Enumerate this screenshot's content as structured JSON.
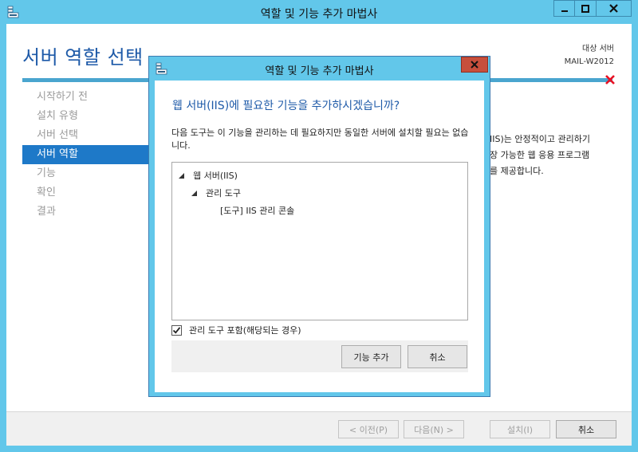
{
  "main_window": {
    "title": "역할 및 기능 추가 마법사",
    "page_title": "서버 역할 선택",
    "target_server_label": "대상 서버",
    "target_server_name": "MAIL-W2012",
    "nav_items": [
      {
        "label": "시작하기 전",
        "active": false
      },
      {
        "label": "설치 유형",
        "active": false
      },
      {
        "label": "서버 선택",
        "active": false
      },
      {
        "label": "서버 역할",
        "active": true
      },
      {
        "label": "기능",
        "active": false
      },
      {
        "label": "확인",
        "active": false
      },
      {
        "label": "결과",
        "active": false
      }
    ],
    "description_lines": [
      "IIS)는 안정적이고 관리하기",
      "장 가능한 웹 응용 프로그램",
      "를 제공합니다."
    ],
    "buttons": {
      "prev": "< 이전(P)",
      "next": "다음(N) >",
      "install": "설치(I)",
      "cancel": "취소"
    }
  },
  "dialog": {
    "title": "역할 및 기능 추가 마법사",
    "heading": "웹 서버(IIS)에 필요한 기능을 추가하시겠습니까?",
    "description": "다음 도구는 이 기능을 관리하는 데 필요하지만 동일한 서버에 설치할 필요는 없습니다.",
    "tree": [
      {
        "label": "웹 서버(IIS)",
        "level": 0,
        "expanded": true
      },
      {
        "label": "관리 도구",
        "level": 1,
        "expanded": true
      },
      {
        "label": "[도구] IIS 관리 콘솔",
        "level": 2,
        "expanded": false
      }
    ],
    "include_tools_label": "관리 도구 포함(해당되는 경우)",
    "include_tools_checked": true,
    "buttons": {
      "add_features": "기능 추가",
      "cancel": "취소"
    }
  },
  "colors": {
    "chrome": "#62c7ea",
    "accent": "#1e5aa8",
    "nav_active": "#1e79c8",
    "dialog_close": "#c74f3c",
    "error_icon": "#e81123"
  }
}
